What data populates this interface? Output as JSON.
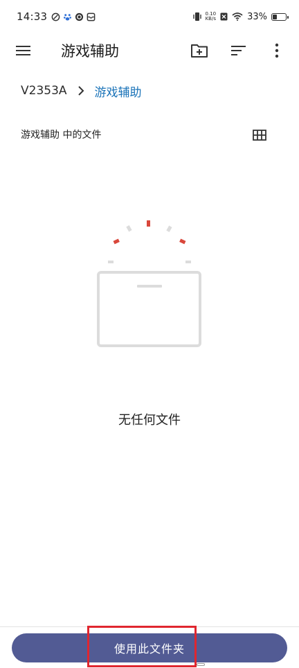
{
  "status_bar": {
    "time": "14:33",
    "net_speed_value": "0.10",
    "net_speed_unit": "KB/s",
    "battery_percent": "33%",
    "battery_level": 0.33
  },
  "app_bar": {
    "title": "游戏辅助",
    "icons": [
      "menu-icon",
      "new-folder-icon",
      "sort-icon",
      "more-vert-icon"
    ]
  },
  "breadcrumb": {
    "root": "V2353A",
    "current": "游戏辅助"
  },
  "section": {
    "header": "游戏辅助 中的文件",
    "view_icon": "grid-view-icon"
  },
  "empty_state": {
    "message": "无任何文件"
  },
  "bottom": {
    "button_label": "使用此文件夹"
  },
  "colors": {
    "accent": "#1a73b8",
    "button_bg": "#525b94",
    "highlight": "#e0262f",
    "illustration_red": "#d9473b",
    "illustration_gray": "#dcdcdc"
  }
}
